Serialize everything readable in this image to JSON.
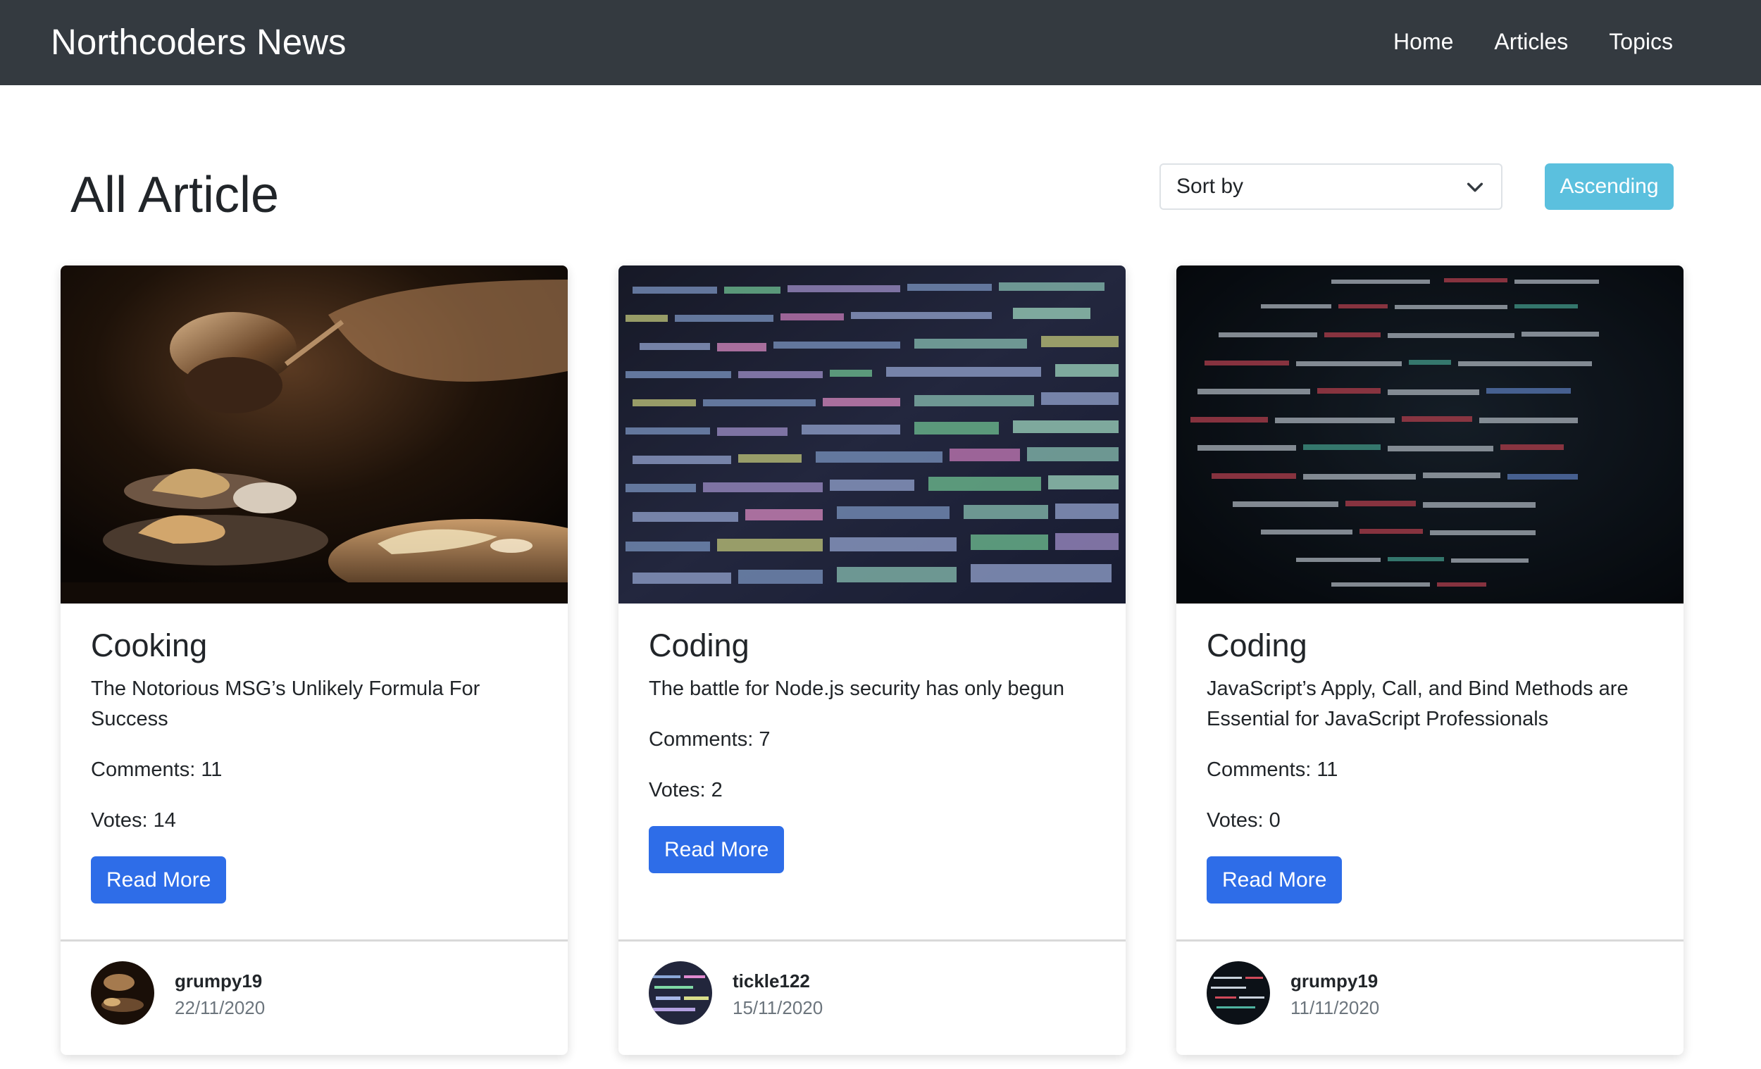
{
  "navbar": {
    "brand": "Northcoders News",
    "links": [
      "Home",
      "Articles",
      "Topics"
    ]
  },
  "header": {
    "title": "All Article",
    "sort_label": "Sort by",
    "order_button": "Ascending"
  },
  "colors": {
    "navbar_bg": "#343a40",
    "primary_button": "#2e6de8",
    "info_button": "#5bc0de"
  },
  "articles": [
    {
      "topic": "Cooking",
      "title": "The Notorious MSG’s Unlikely Formula For Success",
      "comments": "Comments: 11",
      "votes": "Votes: 14",
      "button": "Read More",
      "author": "grumpy19",
      "date": "22/11/2020",
      "image": "cooking-photo"
    },
    {
      "topic": "Coding",
      "title": "The battle for Node.js security has only begun",
      "comments": "Comments: 7",
      "votes": "Votes: 2",
      "button": "Read More",
      "author": "tickle122",
      "date": "15/11/2020",
      "image": "code-screen-photo"
    },
    {
      "topic": "Coding",
      "title": "JavaScript’s Apply, Call, and Bind Methods are Essential for JavaScript Professionals",
      "comments": "Comments: 11",
      "votes": "Votes: 0",
      "button": "Read More",
      "author": "grumpy19",
      "date": "11/11/2020",
      "image": "dark-code-photo"
    }
  ]
}
